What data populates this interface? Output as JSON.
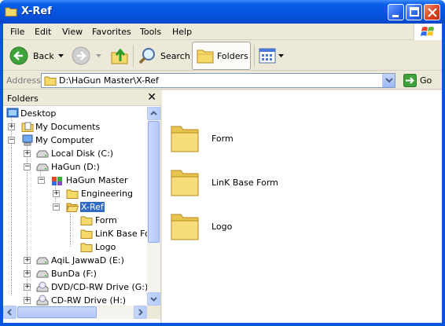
{
  "window": {
    "title": "X-Ref"
  },
  "menu": {
    "items": [
      "File",
      "Edit",
      "View",
      "Favorites",
      "Tools",
      "Help"
    ]
  },
  "toolbar": {
    "back_label": "Back",
    "search_label": "Search",
    "folders_label": "Folders"
  },
  "address": {
    "label": "Address",
    "value": "D:\\HaGun Master\\X-Ref",
    "go_label": "Go"
  },
  "folders_pane": {
    "title": "Folders",
    "close_glyph": "✕",
    "tree": [
      {
        "label": "Desktop",
        "icon": "desktop-icon",
        "expander": ""
      },
      {
        "label": "My Documents",
        "icon": "my-documents-icon",
        "expander": "+"
      },
      {
        "label": "My Computer",
        "icon": "my-computer-icon",
        "expander": "−"
      },
      {
        "label": "Local Disk (C:)",
        "icon": "drive-icon",
        "expander": "+"
      },
      {
        "label": "HaGun (D:)",
        "icon": "drive-icon",
        "expander": "−"
      },
      {
        "label": "HaGun Master",
        "icon": "special-folder-icon",
        "expander": "−"
      },
      {
        "label": "Engineering",
        "icon": "folder-icon",
        "expander": "+"
      },
      {
        "label": "X-Ref",
        "icon": "folder-open-icon",
        "expander": "−",
        "selected": true
      },
      {
        "label": "Form",
        "icon": "folder-icon",
        "expander": ""
      },
      {
        "label": "LinK Base Form",
        "icon": "folder-icon",
        "expander": ""
      },
      {
        "label": "Logo",
        "icon": "folder-icon",
        "expander": ""
      },
      {
        "label": "AqiL JawwaD (E:)",
        "icon": "drive-icon",
        "expander": "+"
      },
      {
        "label": "BunDa (F:)",
        "icon": "drive-icon",
        "expander": "+"
      },
      {
        "label": "DVD/CD-RW Drive (G:)",
        "icon": "cd-drive-icon",
        "expander": "+"
      },
      {
        "label": "CD-RW Drive (H:)",
        "icon": "cd-drive-icon",
        "expander": "+"
      }
    ]
  },
  "content": {
    "items": [
      {
        "name": "Form",
        "icon": "folder-icon"
      },
      {
        "name": "LinK Base Form",
        "icon": "folder-icon"
      },
      {
        "name": "Logo",
        "icon": "folder-icon"
      }
    ]
  },
  "colors": {
    "titlebar": "#0553de",
    "selection": "#316ac5",
    "chrome": "#ece9d8",
    "folder": "#f5d96b"
  }
}
